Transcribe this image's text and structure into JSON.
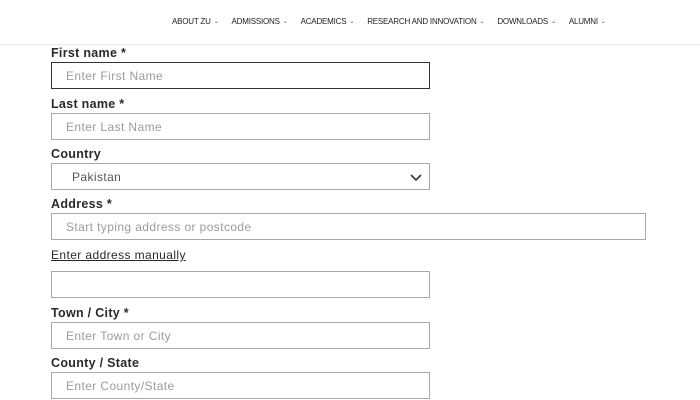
{
  "nav": {
    "items": [
      {
        "label": "ABOUT ZU"
      },
      {
        "label": "ADMISSIONS"
      },
      {
        "label": "ACADEMICS"
      },
      {
        "label": "RESEARCH AND INNOVATION"
      },
      {
        "label": "DOWNLOADS"
      },
      {
        "label": "ALUMNI"
      }
    ]
  },
  "form": {
    "first_name": {
      "label": "First name *",
      "placeholder": "Enter First Name",
      "value": ""
    },
    "last_name": {
      "label": "Last name *",
      "placeholder": "Enter Last Name",
      "value": ""
    },
    "country": {
      "label": "Country",
      "value": "Pakistan"
    },
    "address": {
      "label": "Address *",
      "placeholder": "Start typing address or postcode",
      "value": ""
    },
    "manual_link": "Enter address manually",
    "address_manual": {
      "value": ""
    },
    "town": {
      "label": "Town / City *",
      "placeholder": "Enter Town or City",
      "value": ""
    },
    "county": {
      "label": "County / State",
      "placeholder": "Enter County/State",
      "value": ""
    }
  },
  "icons": {
    "nav_chevron": "chevron-down-icon",
    "select_chevron": "chevron-down-icon"
  }
}
